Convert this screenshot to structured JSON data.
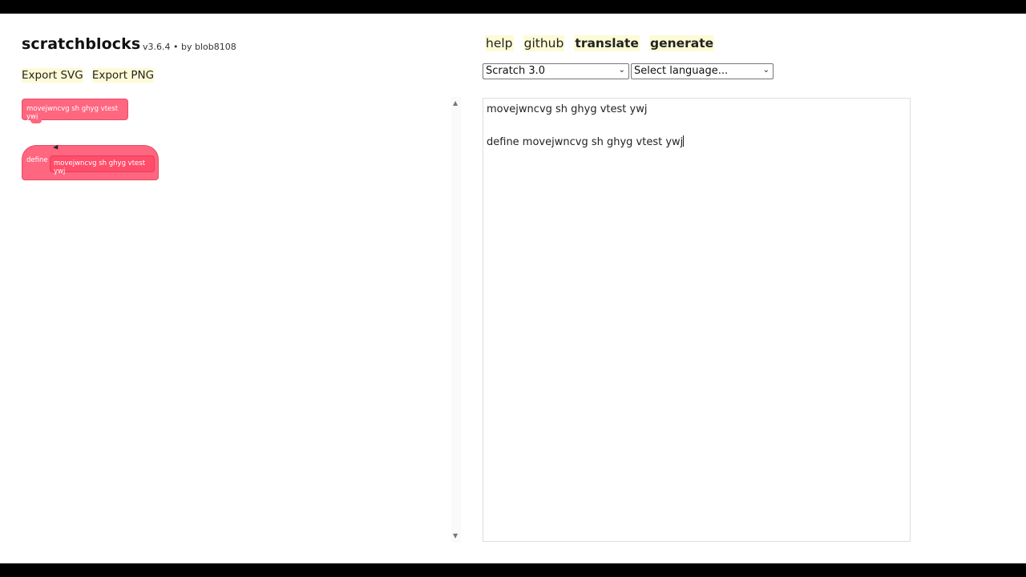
{
  "header": {
    "title": "scratchblocks",
    "version_text": "v3.6.4 • by ",
    "author": "blob8108"
  },
  "export": {
    "svg_label": "Export SVG",
    "png_label": "Export PNG"
  },
  "nav": {
    "help": "help",
    "github": "github",
    "translate": "translate",
    "generate": "generate"
  },
  "selects": {
    "version_selected": "Scratch 3.0",
    "language_selected": "Select language..."
  },
  "blocks": {
    "call_label": "movejwncvg sh ghyg vtest ywj",
    "define_keyword": "define",
    "define_label": "movejwncvg sh ghyg vtest ywj",
    "color": "#ff6680"
  },
  "editor": {
    "lines": [
      "movejwncvg sh ghyg vtest ywj",
      "",
      "define movejwncvg sh ghyg vtest ywj"
    ]
  },
  "icons": {
    "scroll_up": "▲",
    "scroll_down": "▼",
    "select_arrow": "⌄"
  }
}
